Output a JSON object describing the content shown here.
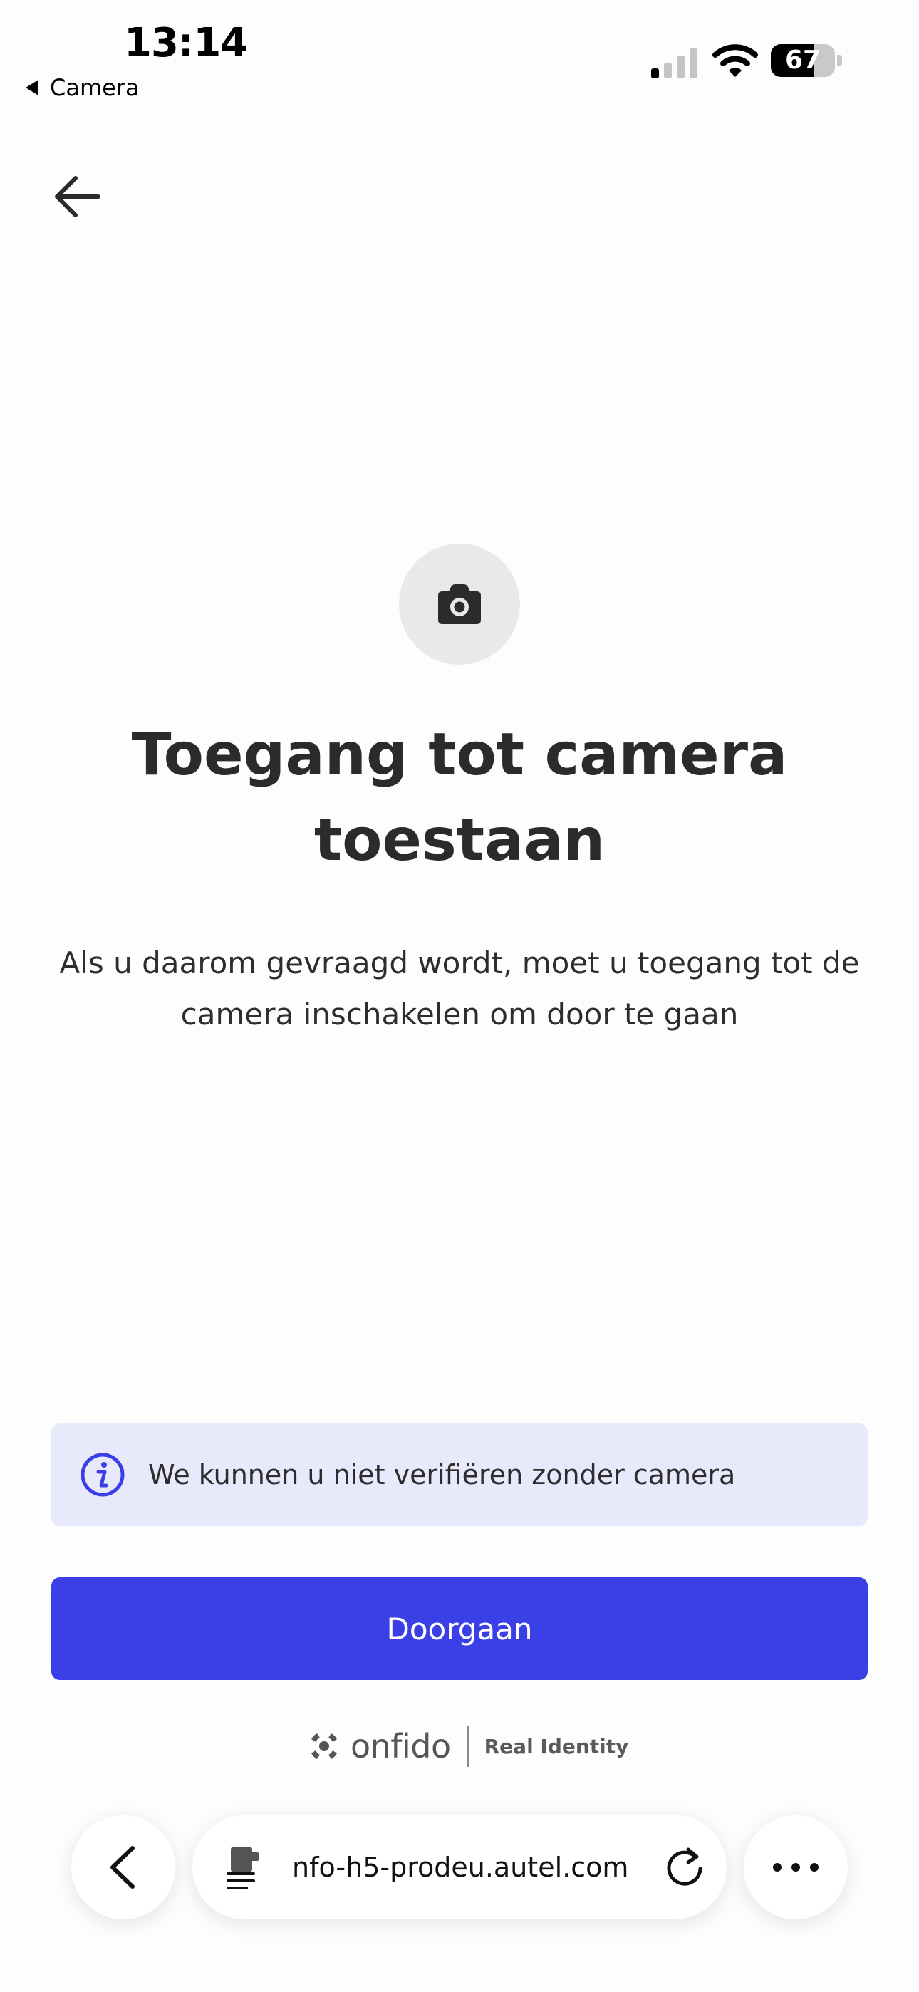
{
  "status_bar": {
    "time": "13:14",
    "back_app": "Camera",
    "battery_level": "67",
    "battery_fraction": 0.67
  },
  "header": {
    "back_icon": "arrow-left-icon"
  },
  "main": {
    "camera_icon": "camera-icon",
    "title": "Toegang tot camera toestaan",
    "subtitle": "Als u daarom gevraagd wordt, moet u toegang tot de camera inschakelen om door te gaan"
  },
  "info": {
    "icon": "info-icon",
    "text": "We kunnen u niet verifiëren zonder camera"
  },
  "actions": {
    "continue_label": "Doorgaan"
  },
  "brand": {
    "name": "onfido",
    "tagline": "Real Identity"
  },
  "browser": {
    "url": "nfo-h5-prodeu.autel.com",
    "back_icon": "chevron-left-icon",
    "site_icon": "site-settings-icon",
    "reload_icon": "reload-icon",
    "more_icon": "more-icon"
  },
  "colors": {
    "primary": "#3a40e6",
    "info_bg": "#e8e9fb",
    "info_icon": "#3a40e6",
    "text": "#2b2b2e"
  }
}
